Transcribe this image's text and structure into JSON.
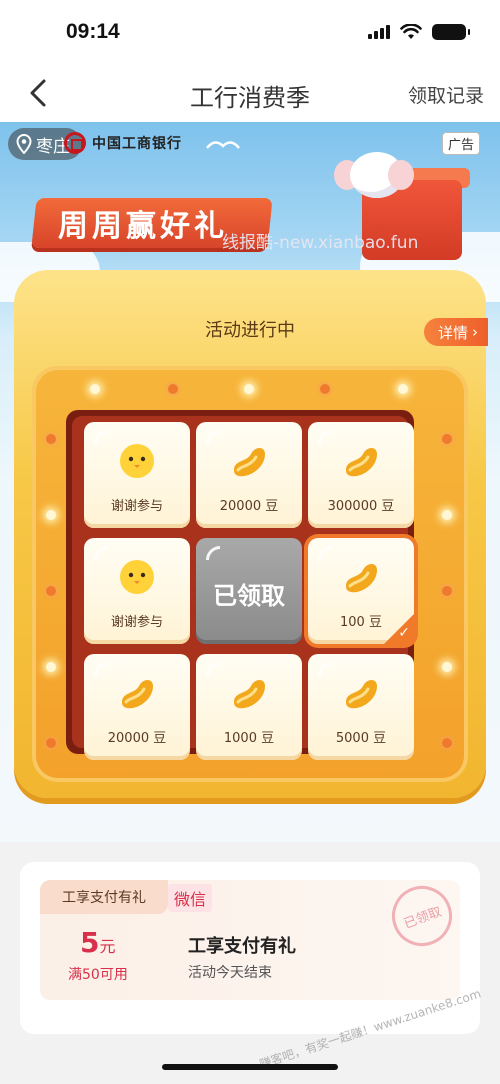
{
  "status_bar": {
    "time": "09:14"
  },
  "nav": {
    "title": "工行消费季",
    "right_link": "领取记录"
  },
  "banner": {
    "location": "枣庄",
    "bank_name": "中国工商银行",
    "ad_label": "广告",
    "promo_title": "周周赢好礼",
    "watermark": "线报酷-new.xianbao.fun"
  },
  "lottery": {
    "status_title": "活动进行中",
    "detail_label": "详情",
    "center_label": "已领取",
    "prizes": [
      {
        "label": "谢谢参与",
        "icon": "chick-icon"
      },
      {
        "label": "20000 豆",
        "icon": "bean-icon"
      },
      {
        "label": "300000 豆",
        "icon": "bean-icon"
      },
      {
        "label": "谢谢参与",
        "icon": "chick-icon"
      },
      {
        "label": "100 豆",
        "icon": "bean-icon",
        "selected": true
      },
      {
        "label": "20000 豆",
        "icon": "bean-icon"
      },
      {
        "label": "1000 豆",
        "icon": "bean-icon"
      },
      {
        "label": "5000 豆",
        "icon": "bean-icon"
      }
    ]
  },
  "coupon": {
    "tag": "工享支付有礼",
    "channel": "微信",
    "amount": "5",
    "amount_unit": "元",
    "condition": "满50可用",
    "name": "工享支付有礼",
    "status": "活动今天结束",
    "stamp": "已领取"
  },
  "corner_watermark": "赚客吧，有奖一起赚！www.zuanke8.com"
}
